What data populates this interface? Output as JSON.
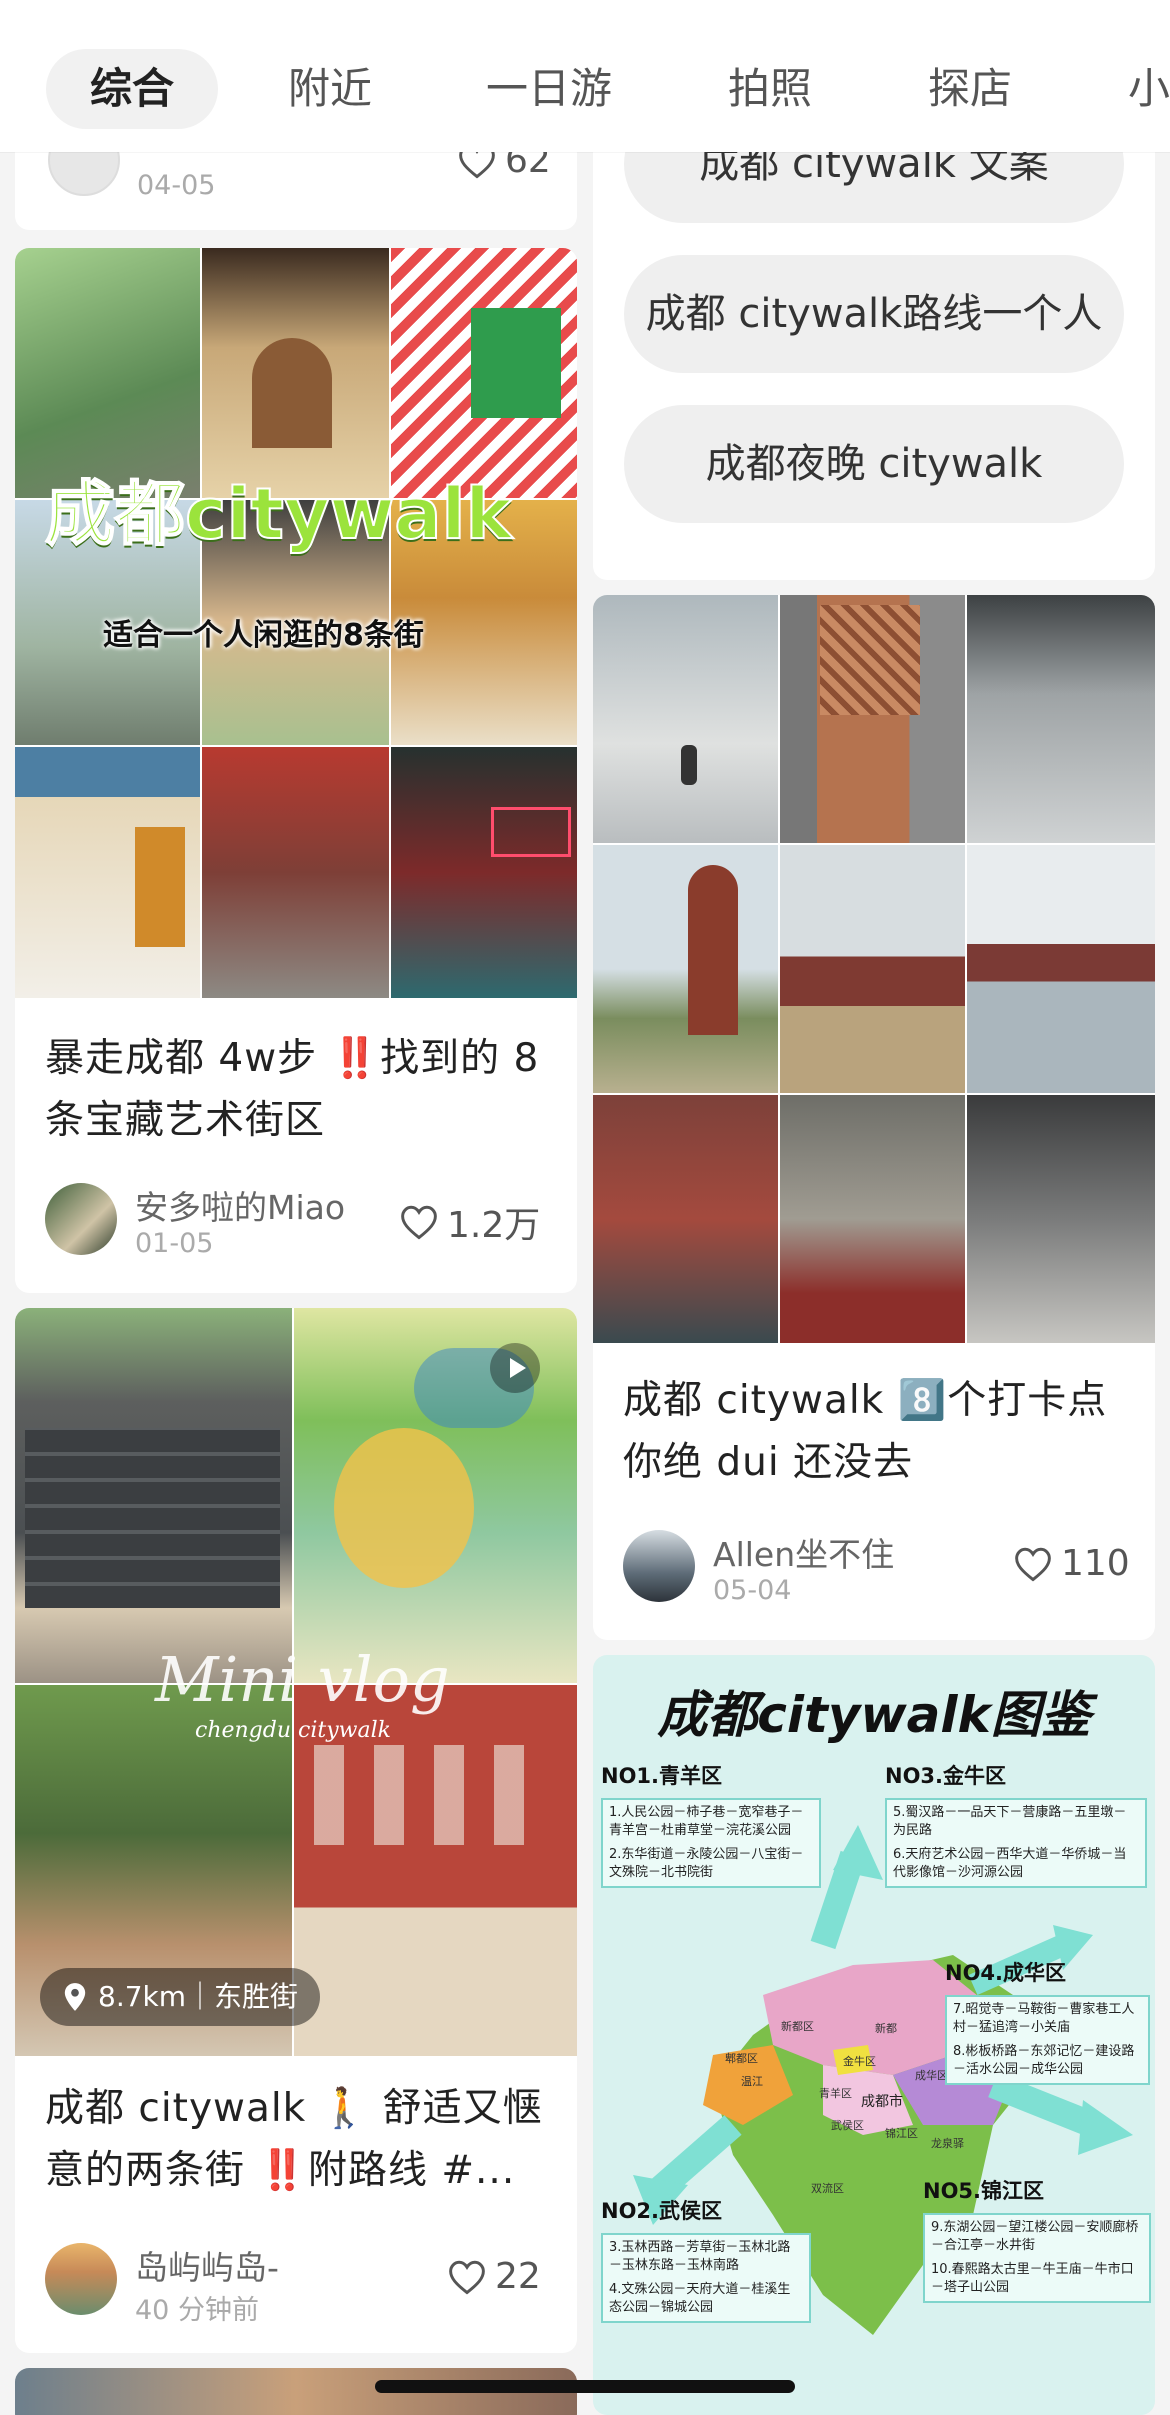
{
  "tabs": [
    {
      "label": "综合",
      "active": true
    },
    {
      "label": "附近"
    },
    {
      "label": "一日游"
    },
    {
      "label": "拍照"
    },
    {
      "label": "探店"
    },
    {
      "label": "小"
    }
  ],
  "left_column": {
    "partial_card": {
      "date": "04-05",
      "likes": "62"
    },
    "card1": {
      "overlay_title": "成都citywalk",
      "overlay_subtitle": "适合一个人闲逛的8条街",
      "title": "暴走成都 4w步 ‼️找到的 8条宝藏艺术街区",
      "author": "安多啦的Miao",
      "date": "01-05",
      "likes": "1.2万"
    },
    "card2": {
      "overlay_script": "Mini vlog",
      "overlay_script_sub": "chengdu citywalk",
      "location": "8.7km｜东胜街",
      "title": "成都 citywalk 🚶 舒适又惬意的两条街 ‼️附路线 #...",
      "author": "岛屿屿岛-",
      "date": "40 分钟前",
      "likes": "22"
    }
  },
  "right_column": {
    "suggestions": [
      "成都 citywalk 文案",
      "成都 citywalk路线一个人",
      "成都夜晚 citywalk"
    ],
    "card1": {
      "title": "成都 citywalk 8️⃣个打卡点 你绝 dui 还没去",
      "author": "Allen坐不住",
      "date": "05-04",
      "likes": "110"
    },
    "card2": {
      "map_title": "成都citywalk图鉴",
      "regions": [
        {
          "name": "NO1.青羊区",
          "routes": [
            "1.人民公园－柿子巷－宽窄巷子－青羊宫－杜甫草堂－浣花溪公园",
            "2.东华街道－永陵公园－八宝街－文殊院－北书院街"
          ]
        },
        {
          "name": "NO3.金牛区",
          "routes": [
            "5.蜀汉路－一品天下－营康路－五里墩－为民路",
            "6.天府艺术公园－西华大道－华侨城－当代影像馆－沙河源公园"
          ]
        },
        {
          "name": "NO4.成华区",
          "routes": [
            "7.昭觉寺－马鞍街－曹家巷工人村－猛追湾－小关庙",
            "8.彬板桥路－东郊记忆－建设路－活水公园－成华公园"
          ]
        },
        {
          "name": "NO2.武侯区",
          "routes": [
            "3.玉林西路－芳草街－玉林北路－玉林东路－玉林南路",
            "4.文殊公园－天府大道－桂溪生态公园－锦城公园"
          ]
        },
        {
          "name": "NO5.锦江区",
          "routes": [
            "9.东湖公园－望江楼公园－安顺廊桥－合江亭－水井街",
            "10.春熙路太古里－牛王庙－牛市口－塔子山公园"
          ]
        }
      ],
      "map_labels": [
        "新都区",
        "郫都区",
        "金牛区",
        "成华区",
        "温江",
        "青羊区",
        "成都市",
        "武侯区",
        "锦江区",
        "龙泉驿",
        "双流区",
        "新都"
      ]
    }
  },
  "colors": {
    "like_icon": "#555555",
    "neon_green": "#9be33c",
    "map_bg": "#d9f2ef",
    "map_green": "#7cbf4a",
    "map_pink": "#e8a6c8",
    "map_purple": "#b58ad6",
    "map_arrow": "#7fe0d3"
  },
  "icons": [
    "heart-icon",
    "location-pin-icon",
    "play-icon"
  ]
}
